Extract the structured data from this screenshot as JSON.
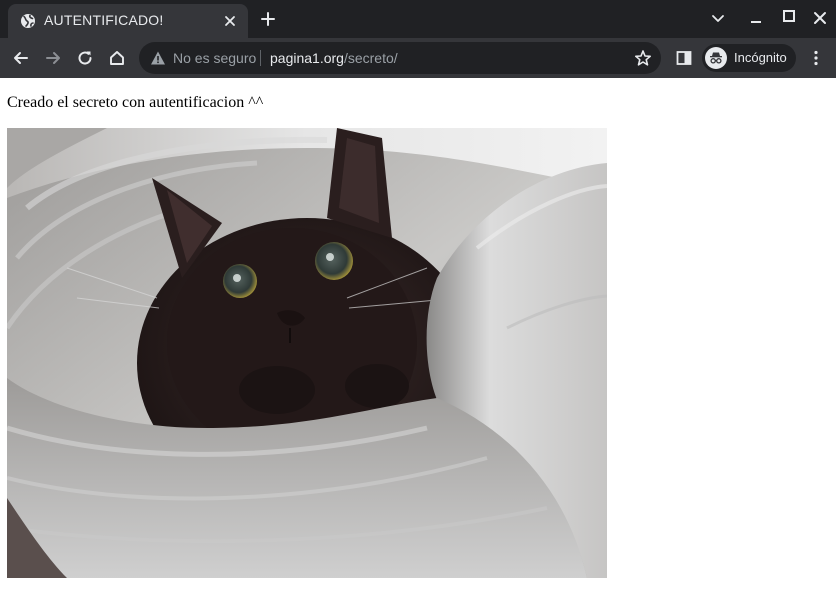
{
  "browser": {
    "tab": {
      "title": "AUTENTIFICADO!",
      "favicon": "globe-icon"
    },
    "toolbar": {
      "security_text": "No es seguro",
      "url_host": "pagina1.org",
      "url_path": "/secreto/",
      "incognito_label": "Incógnito"
    },
    "icons": {
      "back": "arrow-left-icon",
      "forward": "arrow-right-icon",
      "reload": "reload-icon",
      "home": "home-icon",
      "star": "star-icon",
      "sidepanel": "side-panel-icon",
      "menu": "kebab-menu-icon"
    },
    "colors": {
      "frame": "#202124",
      "toolbar": "#35363a",
      "text": "#e8eaed",
      "muted": "#9aa0a6"
    }
  },
  "page": {
    "message": "Creado el secreto con autentificacion ^^",
    "image": "black-cat-in-foam-roll"
  }
}
